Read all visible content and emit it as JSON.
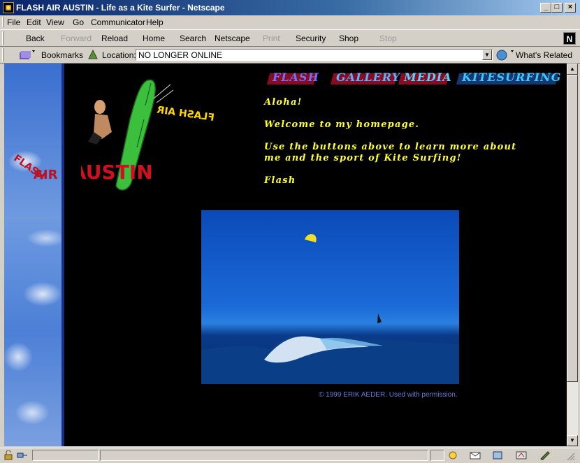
{
  "window": {
    "title": "FLASH AIR AUSTIN - Life as a Kite Surfer - Netscape",
    "controls": [
      "_",
      "□",
      "×"
    ]
  },
  "menu": [
    "File",
    "Edit",
    "View",
    "Go",
    "Communicator",
    "Help"
  ],
  "toolbar": {
    "buttons": [
      {
        "label": "Back",
        "enabled": true
      },
      {
        "label": "Forward",
        "enabled": false
      },
      {
        "label": "Reload",
        "enabled": true
      },
      {
        "label": "Home",
        "enabled": true
      },
      {
        "label": "Search",
        "enabled": true
      },
      {
        "label": "Netscape",
        "enabled": true
      },
      {
        "label": "Print",
        "enabled": false
      },
      {
        "label": "Security",
        "enabled": true
      },
      {
        "label": "Shop",
        "enabled": true
      },
      {
        "label": "Stop",
        "enabled": false
      }
    ],
    "brand_letter": "N"
  },
  "location_bar": {
    "bookmarks_label": "Bookmarks",
    "location_label": "Location:",
    "location_value": "NO LONGER ONLINE",
    "whats_related": "What's Related"
  },
  "page": {
    "nav": [
      "FLASH",
      "GALLERY",
      "MEDIA",
      "KITESURFING"
    ],
    "side_logo": [
      "FLASH",
      "AIR"
    ],
    "logo": {
      "flash_air_mirrored": "FLASH AIR",
      "austin": "AUSTIN"
    },
    "messages": [
      "Aloha!",
      "Welcome to my homepage.",
      "Use the buttons above to learn more about",
      "me and the sport of Kite Surfing!",
      "Flash"
    ],
    "copyright": "© 1999 ERIK AEDER. Used with permission."
  },
  "colors": {
    "title_bar": "#0a246a",
    "chrome": "#d4d0c8",
    "page_bg": "#000000",
    "message_text": "#ffff33",
    "logo_red": "#d01020",
    "copyright_text": "#6a7ad8"
  }
}
